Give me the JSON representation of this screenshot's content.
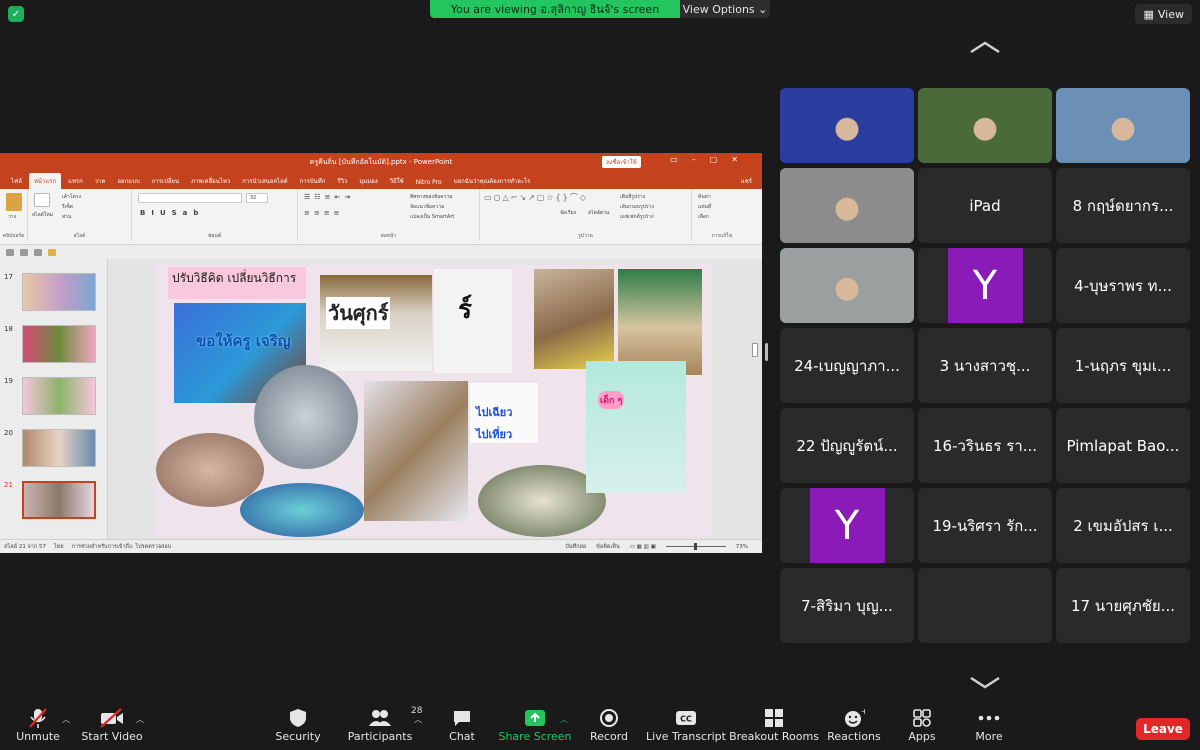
{
  "banner": {
    "viewing_text": "You are viewing อ.สุลิกาญ ธินจ้'s screen",
    "view_options_label": "View Options",
    "view_label": "View"
  },
  "powerpoint": {
    "window_title": "ครูคืนถิ่น [บันทึกอัตโนมัติ].pptx - PowerPoint",
    "sign_in_label": "ลงชื่อเข้าใช้",
    "tabs": [
      "ไฟล์",
      "หน้าแรก",
      "แทรก",
      "วาด",
      "ออกแบบ",
      "การเปลี่ยน",
      "ภาพเคลื่อนไหว",
      "การนำเสนอสไลด์",
      "การบันทึก",
      "รีวิว",
      "มุมมอง",
      "วิธีใช้",
      "Nitro Pro",
      "บอกฉันว่าคุณต้องการทำอะไร"
    ],
    "share_label": "แชร์",
    "ribbon": {
      "paste": "วาง",
      "new_slide": "สไลด์ใหม่",
      "layout": "เค้าโครง",
      "reset": "รีเซ็ต",
      "section": "ส่วน",
      "clipboard": "คลิปบอร์ด",
      "slides": "สไลด์",
      "font": "ฟอนต์",
      "font_size": "32",
      "paragraph": "ย่อหน้า",
      "text_direction": "ทิศทางของข้อความ",
      "align_text": "จัดแนวข้อความ",
      "smartart": "แปลงเป็น SmartArt",
      "arrange": "จัดเรียง",
      "quick_styles": "สไตล์ด่วน",
      "shape_fill": "เติมสีรูปร่าง",
      "shape_outline": "เส้นกรอบรูปร่าง",
      "shape_effects": "เอฟเฟกต์รูปร่าง",
      "drawing": "รูปวาด",
      "find": "ค้นหา",
      "replace": "แทนที่",
      "select": "เลือก",
      "editing": "การแก้ไข"
    },
    "slide_numbers": [
      "17",
      "18",
      "19",
      "20",
      "21"
    ],
    "active_slide": "21",
    "slide": {
      "title": "ปรับวิธีคิด เปลี่ยนวิธีการ",
      "balloon_text": "ขอให้ครู เจริญ",
      "card_word": "วันศุกร์",
      "card_letter": "ร์",
      "label_go_1": "ไปเฉียว",
      "label_go_2": "ไปเที่ยว",
      "board_text": "เด็ก ๆ"
    },
    "status": {
      "slide_count": "สไลด์ 21 จาก 57",
      "language": "ไทย",
      "accessibility": "การช่วยสำหรับการเข้าถึง: โปรดตรวจสอบ",
      "notes": "บันทึกย่อ",
      "comments": "ข้อคิดเห็น",
      "zoom": "73%"
    }
  },
  "participants": [
    {
      "name": "",
      "video": true,
      "color": "#2b3ea0"
    },
    {
      "name": "",
      "video": true,
      "color": "#4a6a3a"
    },
    {
      "name": "",
      "video": true,
      "color": "#6b8fb5"
    },
    {
      "name": "",
      "video": true,
      "color": "#8c8c8c",
      "speaking": true
    },
    {
      "name": "iPad",
      "video": false
    },
    {
      "name": "8 กฤษ์ดยากร...",
      "video": false
    },
    {
      "name": "",
      "video": true,
      "color": "#9aa0a0"
    },
    {
      "name": "",
      "video": false,
      "avatar": "Y"
    },
    {
      "name": "4-บุษราพร ท...",
      "video": false
    },
    {
      "name": "24-เบญญาภา...",
      "video": false
    },
    {
      "name": "3 นางสาวชุ...",
      "video": false
    },
    {
      "name": "1-นฤภร ขุมเ...",
      "video": false
    },
    {
      "name": "22 ปัญญูรัตน์...",
      "video": false
    },
    {
      "name": "16-วรินธร รา...",
      "video": false
    },
    {
      "name": "Pimlapat Bao...",
      "video": false
    },
    {
      "name": "",
      "video": false,
      "avatar": "Y"
    },
    {
      "name": "19-นริศรา รัก...",
      "video": false
    },
    {
      "name": "2 เขมอัปสร เ...",
      "video": false
    },
    {
      "name": "7-สิริมา บุญ...",
      "video": false
    },
    {
      "name": "",
      "video": false
    },
    {
      "name": "17 นายศุภชัย...",
      "video": false
    }
  ],
  "toolbar": {
    "unmute": "Unmute",
    "start_video": "Start Video",
    "security": "Security",
    "participants": "Participants",
    "participants_count": "28",
    "chat": "Chat",
    "share_screen": "Share Screen",
    "record": "Record",
    "live_transcript": "Live Transcript",
    "breakout_rooms": "Breakout Rooms",
    "reactions": "Reactions",
    "apps": "Apps",
    "more": "More",
    "leave": "Leave"
  },
  "colors": {
    "accent_green": "#22c55e",
    "ppt_red": "#c4421e",
    "leave_red": "#e02828",
    "avatar_purple": "#8a1bb8"
  }
}
